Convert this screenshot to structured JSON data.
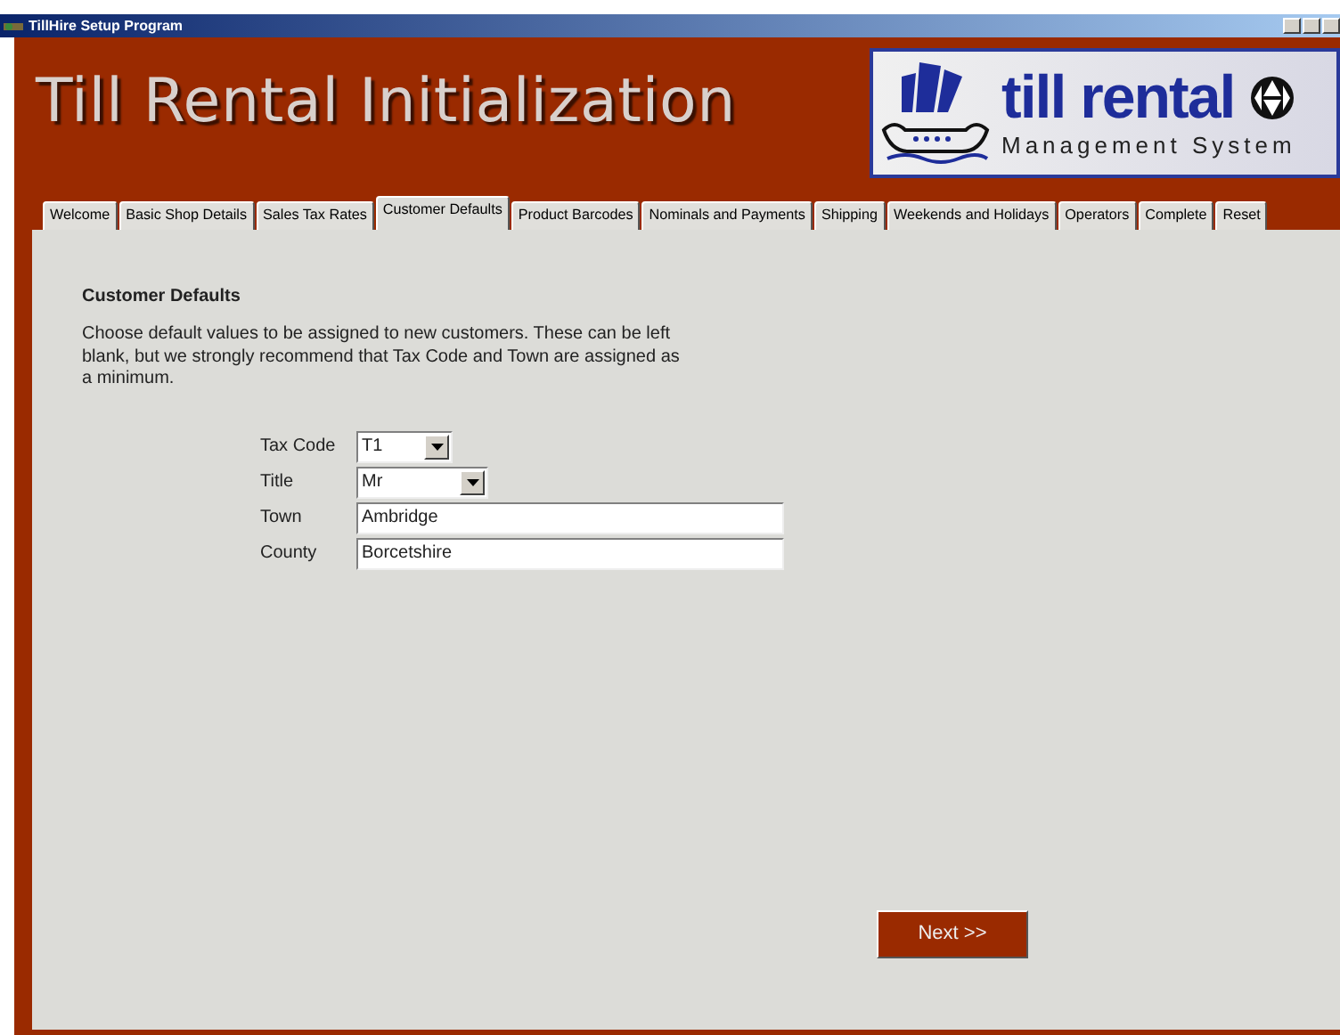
{
  "window": {
    "title": "TillHire Setup Program"
  },
  "header": {
    "title": "Till Rental Initialization",
    "logo": {
      "name": "till rental",
      "tagline": "Management System"
    }
  },
  "tabs": [
    {
      "label": "Welcome",
      "selected": false
    },
    {
      "label": "Basic Shop Details",
      "selected": false
    },
    {
      "label": "Sales Tax Rates",
      "selected": false
    },
    {
      "label": "Customer Defaults",
      "selected": true
    },
    {
      "label": "Product Barcodes",
      "selected": false
    },
    {
      "label": "Nominals and Payments",
      "selected": false
    },
    {
      "label": "Shipping",
      "selected": false
    },
    {
      "label": "Weekends and Holidays",
      "selected": false
    },
    {
      "label": "Operators",
      "selected": false
    },
    {
      "label": "Complete",
      "selected": false
    },
    {
      "label": "Reset",
      "selected": false
    }
  ],
  "section": {
    "heading": "Customer Defaults",
    "description": "Choose default values to be assigned to new customers.  These can be left blank, but we strongly recommend that Tax Code and Town are assigned as a minimum."
  },
  "fields": [
    {
      "label": "Tax Code",
      "kind": "dropdown",
      "value": "T1"
    },
    {
      "label": "Title",
      "kind": "dropdown",
      "value": "Mr"
    },
    {
      "label": "Town",
      "kind": "text",
      "value": "Ambridge"
    },
    {
      "label": "County",
      "kind": "text",
      "value": "Borcetshire"
    }
  ],
  "buttons": [
    {
      "label": "Next >>"
    }
  ]
}
